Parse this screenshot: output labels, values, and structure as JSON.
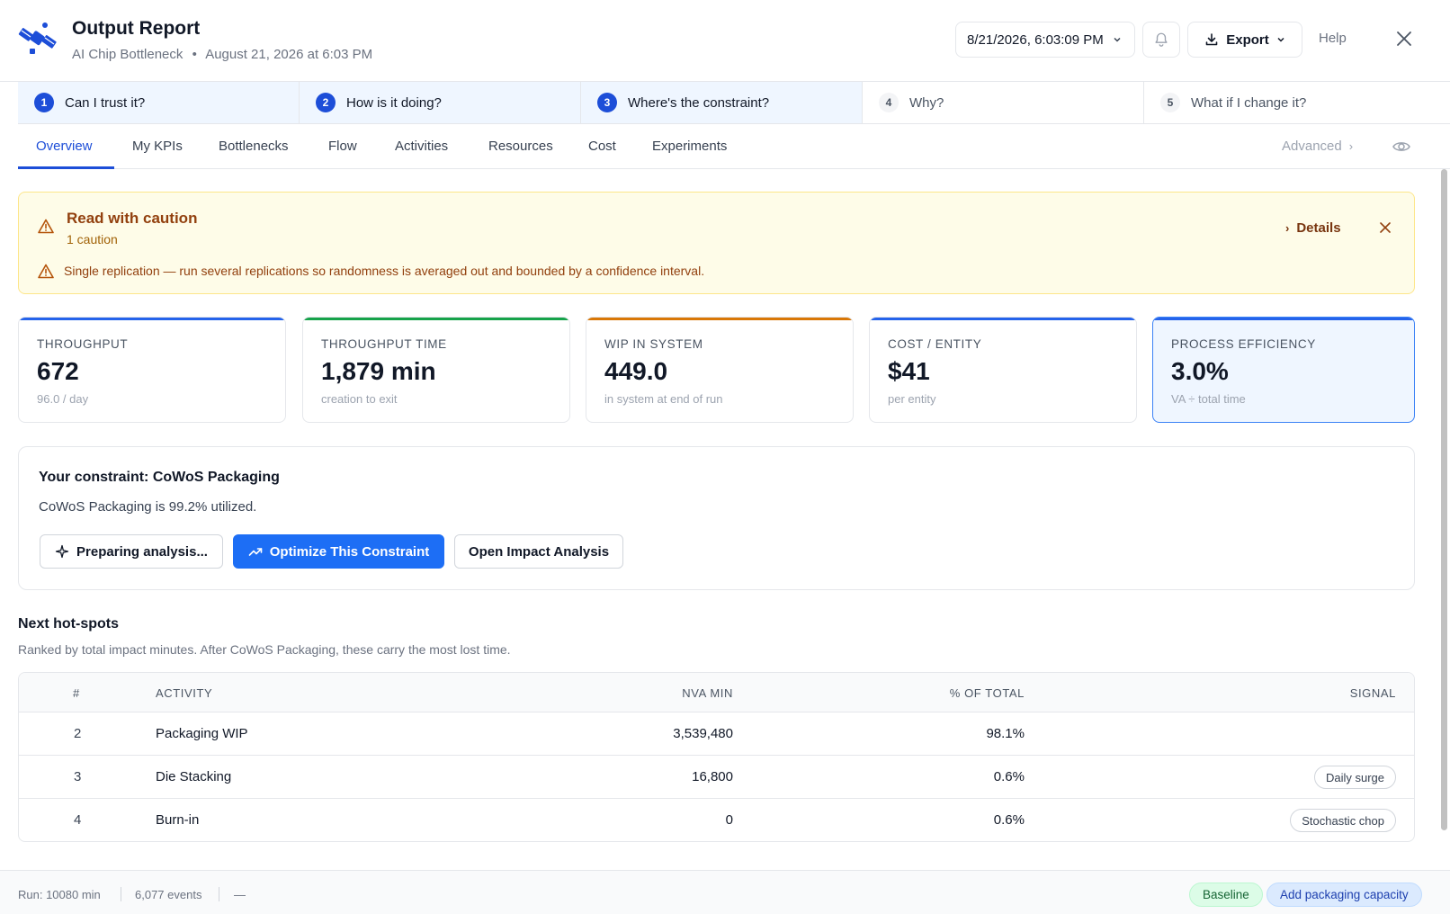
{
  "header": {
    "title": "Output Report",
    "project": "AI Chip Bottleneck",
    "separator": "•",
    "timestamp": "August 21, 2026 at 6:03 PM",
    "date_select_value": "8/21/2026, 6:03:09 PM",
    "export_label": "Export",
    "help_label": "Help"
  },
  "steps": [
    {
      "num": "1",
      "label": "Can I trust it?"
    },
    {
      "num": "2",
      "label": "How is it doing?"
    },
    {
      "num": "3",
      "label": "Where's the constraint?"
    },
    {
      "num": "4",
      "label": "Why?"
    },
    {
      "num": "5",
      "label": "What if I change it?"
    }
  ],
  "tabs": {
    "items": [
      "Overview",
      "My KPIs",
      "Bottlenecks",
      "Flow",
      "Activities",
      "Resources",
      "Cost",
      "Experiments"
    ],
    "active": "Overview",
    "advanced_label": "Advanced"
  },
  "caution": {
    "title": "Read with caution",
    "count": "1 caution",
    "message": "Single replication — run several replications so randomness is averaged out and bounded by a confidence interval.",
    "details_label": "Details"
  },
  "kpis": [
    {
      "label": "Throughput",
      "value": "672",
      "note": "96.0 / day",
      "color": "#2563eb"
    },
    {
      "label": "Throughput Time",
      "value": "1,879 min",
      "note": "creation to exit",
      "color": "#16a34a"
    },
    {
      "label": "WIP in System",
      "value": "449.0",
      "note": "in system at end of run",
      "color": "#d97706"
    },
    {
      "label": "Cost / Entity",
      "value": "$41",
      "note": "per entity",
      "color": "#2563eb"
    },
    {
      "label": "Process Efficiency",
      "value": "3.0%",
      "note": "VA ÷ total time",
      "color": "#2563eb"
    }
  ],
  "constraint": {
    "title": "Your constraint: CoWoS Packaging",
    "description": "CoWoS Packaging is 99.2% utilized.",
    "preparing_label": "Preparing analysis...",
    "optimize_label": "Optimize This Constraint",
    "impact_label": "Open Impact Analysis"
  },
  "hotspots": {
    "title": "Next hot-spots",
    "subtitle": "Ranked by total impact minutes. After CoWoS Packaging, these carry the most lost time.",
    "columns": [
      "#",
      "Activity",
      "NVA min",
      "% of total",
      "Signal"
    ],
    "rows": [
      {
        "rank": "2",
        "activity": "Packaging WIP",
        "nva": "3,539,480",
        "pct": "98.1%",
        "signal": ""
      },
      {
        "rank": "3",
        "activity": "Die Stacking",
        "nva": "16,800",
        "pct": "0.6%",
        "signal": "Daily surge"
      },
      {
        "rank": "4",
        "activity": "Burn-in",
        "nva": "0",
        "pct": "0.6%",
        "signal": "Stochastic chop"
      }
    ]
  },
  "footer": {
    "run": "Run: 10080 min",
    "events": "6,077 events",
    "dash": "—",
    "baseline_label": "Baseline",
    "scenario_label": "Add packaging capacity"
  },
  "icons": {
    "logo": "satellite-logo-icon",
    "bell": "bell-icon",
    "export": "download-icon",
    "close": "close-icon",
    "warning": "warning-icon",
    "sparkle": "sparkle-icon",
    "trend": "trend-up-icon",
    "eye": "eye-icon"
  }
}
